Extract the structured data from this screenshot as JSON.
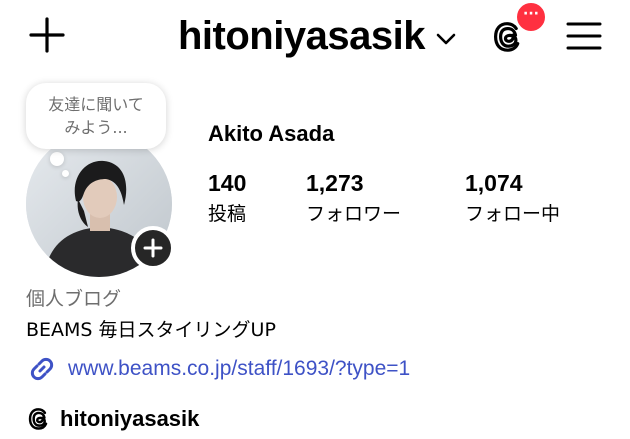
{
  "header": {
    "username": "hitoniyasasik",
    "notification_badge": "···",
    "icons": {
      "create": "plus-icon",
      "switch_account": "chevron-down-icon",
      "threads": "threads-icon",
      "menu": "hamburger-menu-icon"
    }
  },
  "note": {
    "text": "友達に聞いて\nみよう..."
  },
  "profile": {
    "display_name": "Akito Asada",
    "stats": [
      {
        "value": "140",
        "label": "投稿"
      },
      {
        "value": "1,273",
        "label": "フォロワー"
      },
      {
        "value": "1,074",
        "label": "フォロー中"
      }
    ],
    "category": "個人ブログ",
    "bio": "BEAMS 毎日スタイリングUP",
    "link": "www.beams.co.jp/staff/1693/?type=1",
    "threads_handle": "hitoniyasasik"
  },
  "colors": {
    "badge": "#ff3040",
    "link": "#3e52c6",
    "secondary_text": "#6e6e6e",
    "add_button": "#262626"
  }
}
